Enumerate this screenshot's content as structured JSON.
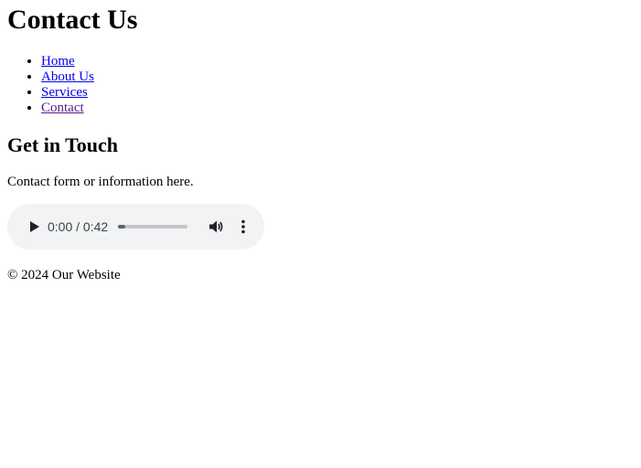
{
  "header": {
    "title": "Contact Us"
  },
  "nav": {
    "items": [
      {
        "label": "Home"
      },
      {
        "label": "About Us"
      },
      {
        "label": "Services"
      },
      {
        "label": "Contact"
      }
    ]
  },
  "main": {
    "heading": "Get in Touch",
    "text": "Contact form or information here."
  },
  "audio": {
    "time": "0:00 / 0:42",
    "progress_fraction": 0.1,
    "icons": [
      "play-icon",
      "volume-icon",
      "more-options-icon"
    ]
  },
  "footer": {
    "text": "© 2024 Our Website"
  },
  "colors": {
    "link": "#0000ee",
    "visited_link": "#551a8b",
    "player_bg": "#f1f3f4"
  }
}
